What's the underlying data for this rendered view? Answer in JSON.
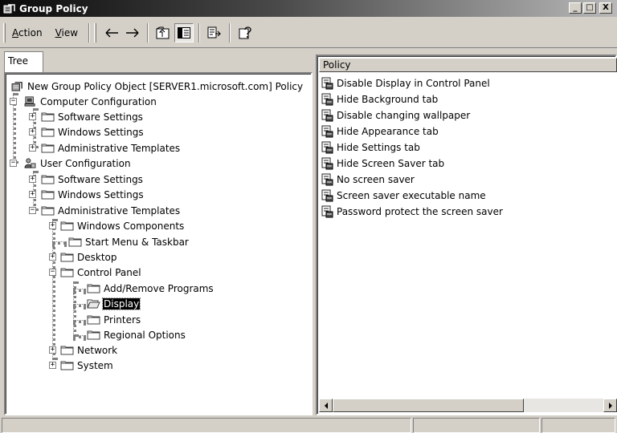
{
  "window": {
    "title": "Group Policy",
    "app_icon": "group-policy-icon",
    "controls": [
      "_",
      "□",
      "X"
    ]
  },
  "toolbar": {
    "menu": [
      {
        "label": "Action",
        "accel": "A"
      },
      {
        "label": "View",
        "accel": "V"
      }
    ],
    "icons": [
      "back-arrow-icon",
      "forward-arrow-icon",
      "up-one-level-icon",
      "show-hide-tree-icon",
      "export-list-icon",
      "help-icon"
    ]
  },
  "tree": {
    "tab_label": "Tree",
    "root": "New Group Policy Object [SERVER1.microsoft.com] Policy",
    "computer_configuration": "Computer Configuration",
    "cc_children": [
      "Software Settings",
      "Windows Settings",
      "Administrative Templates"
    ],
    "user_configuration": "User Configuration",
    "uc_children": [
      "Software Settings",
      "Windows Settings",
      "Administrative Templates"
    ],
    "admin_templates_children": [
      "Windows Components",
      "Start Menu & Taskbar",
      "Desktop",
      "Control Panel"
    ],
    "control_panel_children": [
      "Add/Remove Programs",
      "Display",
      "Printers",
      "Regional Options"
    ],
    "admin_templates_more": [
      "Network",
      "System"
    ],
    "selected": "Display"
  },
  "list": {
    "column_header": "Policy",
    "items": [
      "Disable Display in Control Panel",
      "Hide Background tab",
      "Disable changing wallpaper",
      "Hide Appearance tab",
      "Hide Settings tab",
      "Hide Screen Saver tab",
      "No screen saver",
      "Screen saver executable name",
      "Password protect the screen saver"
    ]
  },
  "status": {
    "cells": [
      "",
      "",
      ""
    ]
  }
}
